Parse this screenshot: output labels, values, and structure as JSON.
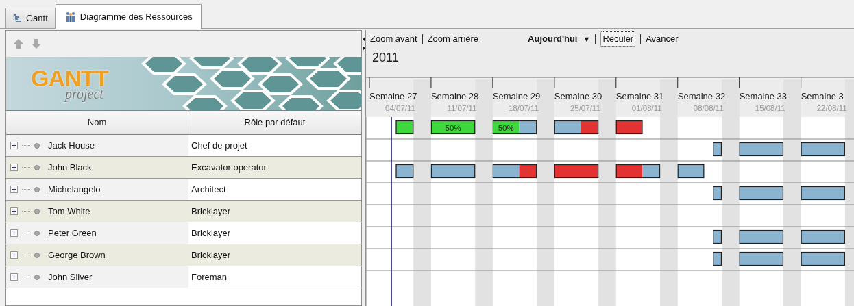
{
  "tabs": [
    {
      "label": "Gantt",
      "kind": "gantt",
      "selected": false
    },
    {
      "label": "Diagramme des Ressources",
      "kind": "people",
      "selected": true
    }
  ],
  "toolbar": [
    {
      "kind": "up",
      "disabled": true
    },
    {
      "kind": "down",
      "disabled": true
    }
  ],
  "logo": {
    "title": "GANTT",
    "subtitle": "project"
  },
  "table": {
    "columns": [
      "Nom",
      "Rôle par défaut"
    ],
    "rows": [
      {
        "name": "Jack House",
        "role": "Chef de projet",
        "expanded": false
      },
      {
        "name": "John Black",
        "role": "Excavator operator",
        "expanded": false
      },
      {
        "name": "Michelangelo",
        "role": "Architect",
        "expanded": false
      },
      {
        "name": "Tom White",
        "role": "Bricklayer",
        "expanded": false
      },
      {
        "name": "Peter Green",
        "role": "Bricklayer",
        "expanded": false
      },
      {
        "name": "George Brown",
        "role": "Bricklayer",
        "expanded": false
      },
      {
        "name": "John Silver",
        "role": "Foreman",
        "expanded": false
      }
    ]
  },
  "chart": {
    "toolbar": {
      "zoom_in": "Zoom avant",
      "zoom_out": "Zoom arrière",
      "today": "Aujourd'hui",
      "today_caret": "▼",
      "back": {
        "label": "Reculer",
        "focused": true
      },
      "forward": "Avancer"
    },
    "year": "2011",
    "weeks": [
      {
        "label": "Semaine 27",
        "date": "04/07/11"
      },
      {
        "label": "Semaine 28",
        "date": "11/07/11"
      },
      {
        "label": "Semaine 29",
        "date": "18/07/11"
      },
      {
        "label": "Semaine 30",
        "date": "25/07/11"
      },
      {
        "label": "Semaine 31",
        "date": "01/08/11"
      },
      {
        "label": "Semaine 32",
        "date": "08/08/11"
      },
      {
        "label": "Semaine 33",
        "date": "15/08/11"
      },
      {
        "label": "Semaine 3",
        "date": "22/08/11"
      }
    ],
    "bar_labels": [
      "50%",
      "50%"
    ]
  }
}
